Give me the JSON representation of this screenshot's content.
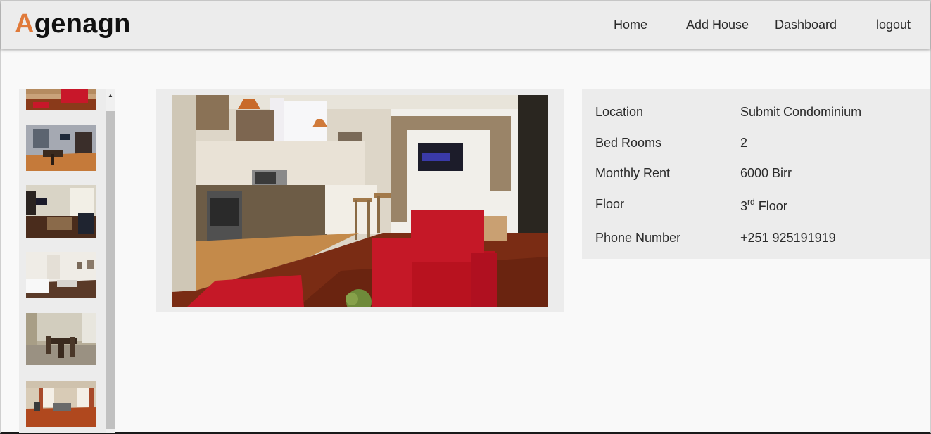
{
  "brand": {
    "first_letter": "A",
    "rest": "genagn",
    "accent_color": "#e07a3a"
  },
  "nav": {
    "home": "Home",
    "add_house": "Add House",
    "dashboard": "Dashboard",
    "logout": "logout"
  },
  "thumbnails": [
    {
      "icon": "living-room-red-chair-photo"
    },
    {
      "icon": "dining-room-photo"
    },
    {
      "icon": "tv-lounge-photo"
    },
    {
      "icon": "white-living-room-photo"
    },
    {
      "icon": "dining-table-photo"
    },
    {
      "icon": "living-room-windows-photo"
    }
  ],
  "main_photo": {
    "icon": "kitchen-living-room-photo"
  },
  "details": {
    "location_label": "Location",
    "location_value": "Submit Condominium",
    "bedrooms_label": "Bed Rooms",
    "bedrooms_value": "2",
    "rent_label": "Monthly Rent",
    "rent_value": "6000 Birr",
    "floor_label": "Floor",
    "floor_number": "3",
    "floor_suffix": "rd",
    "floor_word": "Floor",
    "phone_label": "Phone Number",
    "phone_value": "+251 925191919"
  }
}
